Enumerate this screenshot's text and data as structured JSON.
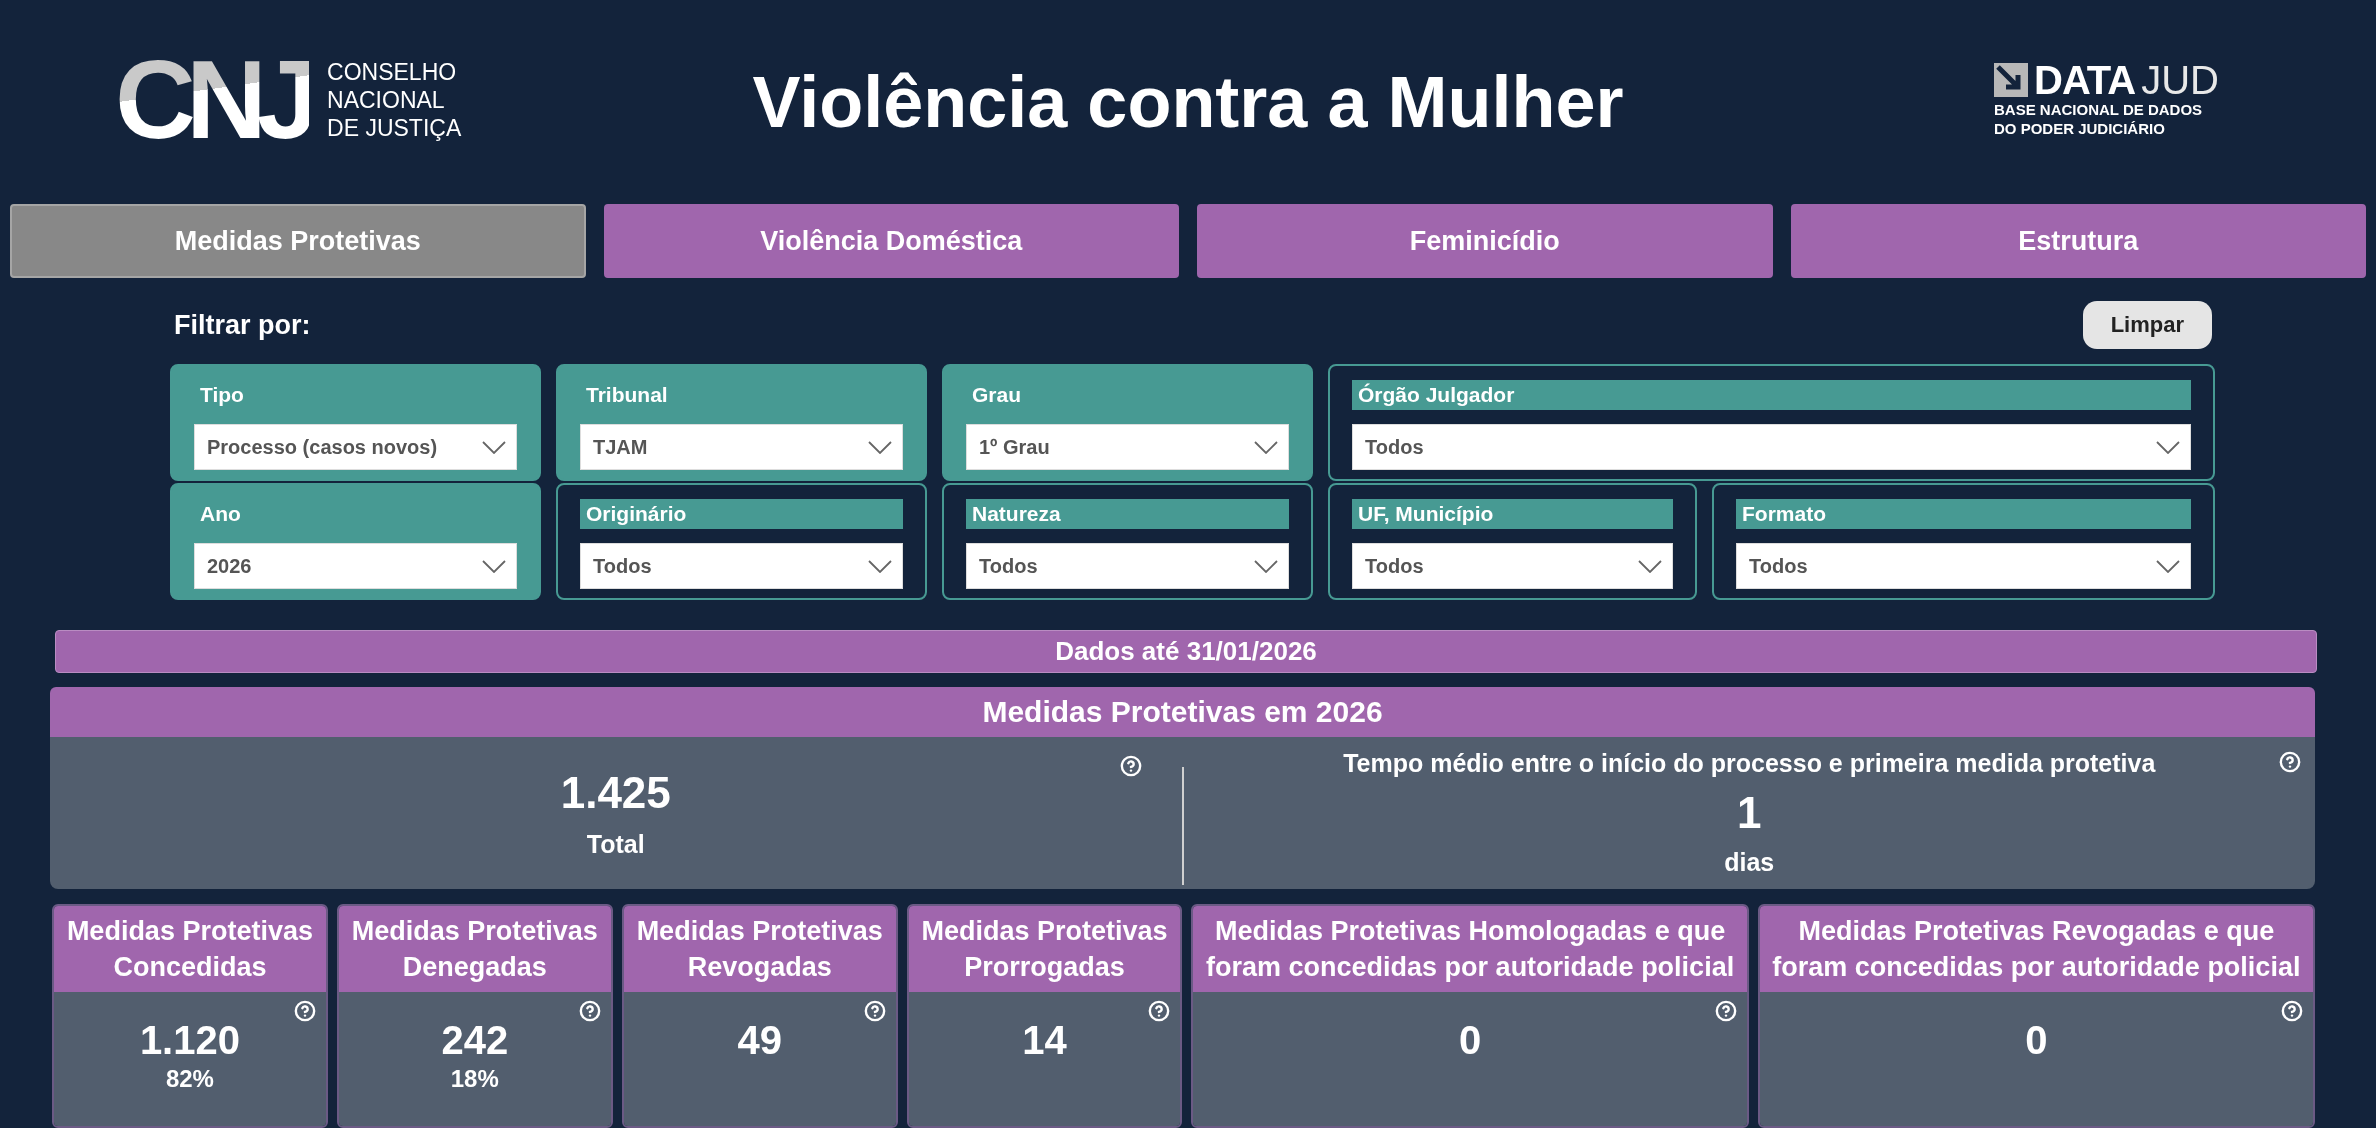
{
  "header": {
    "logo": {
      "mark": "CNJ",
      "lines": [
        "CONSELHO",
        "NACIONAL",
        "DE JUSTIÇA"
      ]
    },
    "title": "Violência contra a Mulher",
    "datajud": {
      "bold": "DATA",
      "light": "JUD",
      "lines": [
        "BASE NACIONAL DE DADOS",
        "DO PODER JUDICIÁRIO"
      ]
    }
  },
  "tabs": [
    {
      "label": "Medidas Protetivas",
      "selected": true
    },
    {
      "label": "Violência Doméstica",
      "selected": false
    },
    {
      "label": "Feminicídio",
      "selected": false
    },
    {
      "label": "Estrutura",
      "selected": false
    }
  ],
  "filter_bar": {
    "label": "Filtrar por:",
    "clear_button": "Limpar"
  },
  "filters": [
    {
      "label": "Tipo",
      "value": "Processo (casos novos)",
      "kind": "filled"
    },
    {
      "label": "Tribunal",
      "value": "TJAM",
      "kind": "filled"
    },
    {
      "label": "Grau",
      "value": "1º Grau",
      "kind": "filled"
    },
    {
      "label": "Órgão Julgador",
      "value": "Todos",
      "kind": "outlined"
    },
    {
      "label": "Ano",
      "value": "2026",
      "kind": "filled"
    },
    {
      "label": "Originário",
      "value": "Todos",
      "kind": "outlined"
    },
    {
      "label": "Natureza",
      "value": "Todos",
      "kind": "outlined"
    },
    {
      "label": "UF, Município",
      "value": "Todos",
      "kind": "outlined"
    },
    {
      "label": "Formato",
      "value": "Todos",
      "kind": "outlined"
    }
  ],
  "data_note": "Dados até 31/01/2026",
  "summary": {
    "title": "Medidas Protetivas em 2026",
    "total": {
      "value": "1.425",
      "label": "Total"
    },
    "average_time": {
      "title": "Tempo médio entre o início do processo e primeira medida protetiva",
      "value": "1",
      "unit": "dias"
    }
  },
  "cards": [
    {
      "title": "Medidas Protetivas Concedidas",
      "value": "1.120",
      "share": "82%"
    },
    {
      "title": "Medidas Protetivas Denegadas",
      "value": "242",
      "share": "18%"
    },
    {
      "title": "Medidas Protetivas Revogadas",
      "value": "49"
    },
    {
      "title": "Medidas Protetivas Prorrogadas",
      "value": "14"
    },
    {
      "title": "Medidas Protetivas Homologadas e que foram concedidas por autoridade policial",
      "value": "0"
    },
    {
      "title": "Medidas Protetivas Revogadas e que foram concedidas por autoridade policial",
      "value": "0"
    }
  ]
}
